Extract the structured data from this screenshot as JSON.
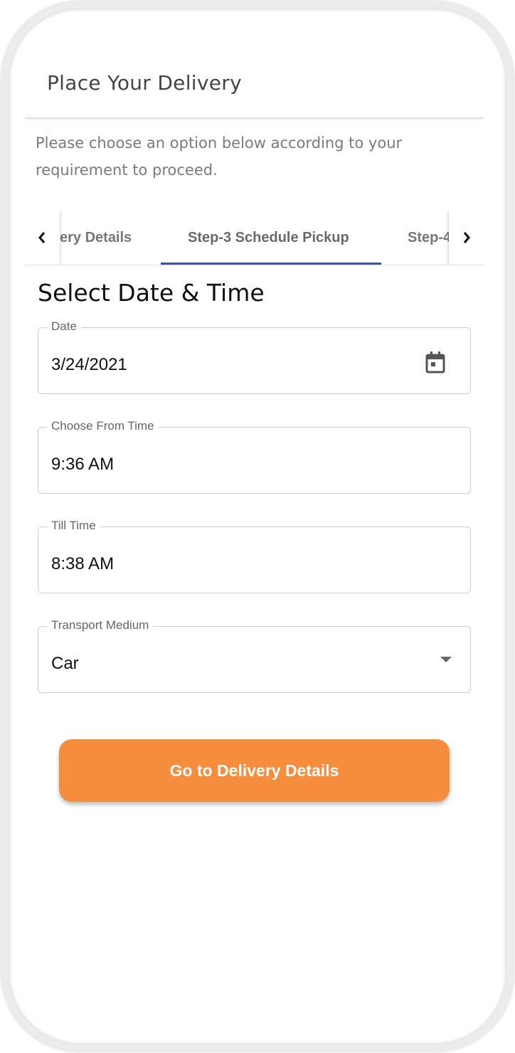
{
  "header": {
    "title": "Place Your Delivery"
  },
  "subtitle": "Please choose an option below according to your requirement to proceed.",
  "tabs": {
    "items": [
      {
        "label": "ery Details"
      },
      {
        "label": "Step-3 Schedule Pickup",
        "active": true
      },
      {
        "label": "Step-4"
      }
    ],
    "left_icon": "chevron-left-icon",
    "right_icon": "chevron-right-icon"
  },
  "section_title": "Select Date & Time",
  "form": {
    "date": {
      "label": "Date",
      "value": "3/24/2021",
      "icon": "calendar-icon"
    },
    "from_time": {
      "label": "Choose From Time",
      "value": "9:36 AM"
    },
    "till_time": {
      "label": "Till Time",
      "value": "8:38 AM"
    },
    "transport": {
      "label": "Transport Medium",
      "value": "Car",
      "icon": "dropdown-arrow-icon"
    }
  },
  "cta": {
    "label": "Go to Delivery Details"
  },
  "colors": {
    "accent": "#f68d3c",
    "tab_indicator": "#3f51b5"
  }
}
